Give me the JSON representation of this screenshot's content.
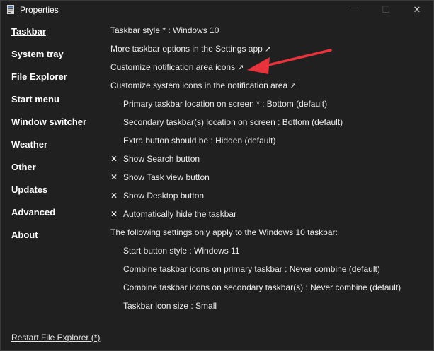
{
  "window": {
    "title": "Properties",
    "minimize_glyph": "—",
    "maximize_glyph": "☐",
    "close_glyph": "✕"
  },
  "sidebar": {
    "items": [
      {
        "label": "Taskbar",
        "active": true
      },
      {
        "label": "System tray"
      },
      {
        "label": "File Explorer"
      },
      {
        "label": "Start menu"
      },
      {
        "label": "Window switcher"
      },
      {
        "label": "Weather"
      },
      {
        "label": "Other"
      },
      {
        "label": "Updates"
      },
      {
        "label": "Advanced"
      },
      {
        "label": "About"
      }
    ],
    "restart_label": "Restart File Explorer (*)"
  },
  "settings": {
    "taskbar_style": "Taskbar style * : Windows 10",
    "more_options": "More taskbar options in the Settings app",
    "notif_icons": "Customize notification area icons",
    "system_icons": "Customize system icons in the notification area",
    "primary_location": "Primary taskbar location on screen * : Bottom (default)",
    "secondary_location": "Secondary taskbar(s) location on screen : Bottom (default)",
    "extra_button": "Extra button should be : Hidden (default)",
    "show_search": "Show Search button",
    "show_taskview": "Show Task view button",
    "show_desktop": "Show Desktop button",
    "auto_hide": "Automatically hide the taskbar",
    "win10_note": "The following settings only apply to the Windows 10 taskbar:",
    "start_style": "Start button style : Windows 11",
    "combine_primary": "Combine taskbar icons on primary taskbar : Never combine (default)",
    "combine_secondary": "Combine taskbar icons on secondary taskbar(s) : Never combine (default)",
    "icon_size": "Taskbar icon size : Small",
    "external_glyph": "↗",
    "check_glyph": "✕"
  },
  "colors": {
    "background": "#202020",
    "annotation_arrow": "#e8323c"
  }
}
